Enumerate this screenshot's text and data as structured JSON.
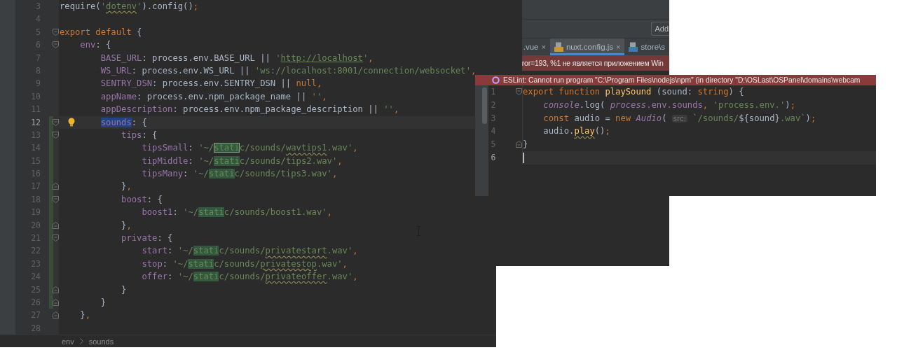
{
  "main_editor": {
    "lines": [
      {
        "number": "3",
        "tokens": [
          {
            "text": "require(",
            "kind": "plain"
          },
          {
            "text": "'",
            "kind": "string"
          },
          {
            "text": "dotenv",
            "kind": "string-typo"
          },
          {
            "text": "'",
            "kind": "string"
          },
          {
            "text": ").config()",
            "kind": "plain"
          },
          {
            "text": ";",
            "kind": "keyword"
          }
        ]
      },
      {
        "number": "4"
      },
      {
        "number": "5",
        "fold_open": true,
        "tokens": [
          {
            "text": "export default ",
            "kind": "keyword"
          },
          {
            "text": "{",
            "kind": "plain"
          }
        ]
      },
      {
        "number": "6",
        "fold_open": true,
        "tokens": [
          {
            "text": "    env",
            "kind": "key"
          },
          {
            "text": ": {",
            "kind": "plain"
          }
        ]
      },
      {
        "number": "7",
        "tokens": [
          {
            "text": "        BASE_URL",
            "kind": "key"
          },
          {
            "text": ": process.env.BASE_URL || ",
            "kind": "plain"
          },
          {
            "text": "'",
            "kind": "string"
          },
          {
            "text": "http://localhost",
            "kind": "string-link"
          },
          {
            "text": "'",
            "kind": "string"
          },
          {
            "text": ",",
            "kind": "keyword"
          }
        ]
      },
      {
        "number": "8",
        "tokens": [
          {
            "text": "        WS_URL",
            "kind": "key"
          },
          {
            "text": ": process.env.WS_URL || ",
            "kind": "plain"
          },
          {
            "text": "'ws://localhost:8001/connection/websocket'",
            "kind": "string"
          },
          {
            "text": ",",
            "kind": "keyword"
          }
        ]
      },
      {
        "number": "9",
        "tokens": [
          {
            "text": "        SENTRY_DSN",
            "kind": "key"
          },
          {
            "text": ": process.env.SENTRY_DSN || ",
            "kind": "plain"
          },
          {
            "text": "null,",
            "kind": "keyword"
          }
        ]
      },
      {
        "number": "10",
        "tokens": [
          {
            "text": "        appName",
            "kind": "key"
          },
          {
            "text": ": process.env.npm_package_name || ",
            "kind": "plain"
          },
          {
            "text": "''",
            "kind": "string"
          },
          {
            "text": ",",
            "kind": "keyword"
          }
        ]
      },
      {
        "number": "11",
        "tokens": [
          {
            "text": "        appDescription",
            "kind": "key"
          },
          {
            "text": ": process.env.npm_package_description || ",
            "kind": "plain"
          },
          {
            "text": "''",
            "kind": "string"
          },
          {
            "text": ",",
            "kind": "keyword"
          }
        ]
      },
      {
        "number": "12",
        "current": true,
        "changed": true,
        "fold_open": true,
        "bulb": true,
        "tokens": [
          {
            "text": "        sounds",
            "kind": "selected"
          },
          {
            "text": ": {",
            "kind": "plain"
          }
        ]
      },
      {
        "number": "13",
        "changed": true,
        "fold_open": true,
        "tokens": [
          {
            "text": "            tips",
            "kind": "key"
          },
          {
            "text": ": {",
            "kind": "plain"
          }
        ]
      },
      {
        "number": "14",
        "changed": true,
        "tokens": [
          {
            "text": "                tipsSmall",
            "kind": "key"
          },
          {
            "text": ": ",
            "kind": "plain"
          },
          {
            "text": "'~/",
            "kind": "string"
          },
          {
            "text": "stati",
            "kind": "match-current"
          },
          {
            "text": "c/sounds/",
            "kind": "string"
          },
          {
            "text": "wavtips1",
            "kind": "string-typo"
          },
          {
            "text": ".wav'",
            "kind": "string"
          },
          {
            "text": ",",
            "kind": "keyword"
          }
        ]
      },
      {
        "number": "15",
        "changed": true,
        "tokens": [
          {
            "text": "                tipMiddle",
            "kind": "key"
          },
          {
            "text": ": ",
            "kind": "plain"
          },
          {
            "text": "'~/",
            "kind": "string"
          },
          {
            "text": "stati",
            "kind": "match"
          },
          {
            "text": "c/sounds/tips2.wav'",
            "kind": "string"
          },
          {
            "text": ",",
            "kind": "keyword"
          }
        ]
      },
      {
        "number": "16",
        "changed": true,
        "tokens": [
          {
            "text": "                tipsMany",
            "kind": "key"
          },
          {
            "text": ": ",
            "kind": "plain"
          },
          {
            "text": "'~/",
            "kind": "string"
          },
          {
            "text": "stati",
            "kind": "match"
          },
          {
            "text": "c/sounds/tips3.wav'",
            "kind": "string"
          },
          {
            "text": ",",
            "kind": "keyword"
          }
        ]
      },
      {
        "number": "17",
        "changed": true,
        "fold_close": true,
        "tokens": [
          {
            "text": "            }",
            "kind": "plain"
          },
          {
            "text": ",",
            "kind": "keyword"
          }
        ]
      },
      {
        "number": "18",
        "changed": true,
        "fold_open": true,
        "tokens": [
          {
            "text": "            boost",
            "kind": "key"
          },
          {
            "text": ": {",
            "kind": "plain"
          }
        ]
      },
      {
        "number": "19",
        "changed": true,
        "tokens": [
          {
            "text": "                boost1",
            "kind": "key"
          },
          {
            "text": ": ",
            "kind": "plain"
          },
          {
            "text": "'~/",
            "kind": "string"
          },
          {
            "text": "stati",
            "kind": "match"
          },
          {
            "text": "c/sounds/boost1.wav'",
            "kind": "string"
          },
          {
            "text": ",",
            "kind": "keyword"
          }
        ]
      },
      {
        "number": "20",
        "changed": true,
        "fold_close": true,
        "tokens": [
          {
            "text": "            }",
            "kind": "plain"
          },
          {
            "text": ",",
            "kind": "keyword"
          }
        ]
      },
      {
        "number": "21",
        "changed": true,
        "fold_open": true,
        "tokens": [
          {
            "text": "            private",
            "kind": "key"
          },
          {
            "text": ": {",
            "kind": "plain"
          }
        ]
      },
      {
        "number": "22",
        "changed": true,
        "tokens": [
          {
            "text": "                start",
            "kind": "key"
          },
          {
            "text": ": ",
            "kind": "plain"
          },
          {
            "text": "'~/",
            "kind": "string"
          },
          {
            "text": "stati",
            "kind": "match"
          },
          {
            "text": "c/sounds/",
            "kind": "string"
          },
          {
            "text": "privatestart",
            "kind": "string-typo"
          },
          {
            "text": ".wav'",
            "kind": "string"
          },
          {
            "text": ",",
            "kind": "keyword"
          }
        ]
      },
      {
        "number": "23",
        "changed": true,
        "tokens": [
          {
            "text": "                stop",
            "kind": "key"
          },
          {
            "text": ": ",
            "kind": "plain"
          },
          {
            "text": "'~/",
            "kind": "string"
          },
          {
            "text": "stati",
            "kind": "match"
          },
          {
            "text": "c/sounds/",
            "kind": "string"
          },
          {
            "text": "privatestop",
            "kind": "string-typo"
          },
          {
            "text": ".wav'",
            "kind": "string"
          },
          {
            "text": ",",
            "kind": "keyword"
          }
        ]
      },
      {
        "number": "24",
        "changed": true,
        "tokens": [
          {
            "text": "                offer",
            "kind": "key"
          },
          {
            "text": ": ",
            "kind": "plain"
          },
          {
            "text": "'~/",
            "kind": "string"
          },
          {
            "text": "stati",
            "kind": "match"
          },
          {
            "text": "c/sounds/",
            "kind": "string"
          },
          {
            "text": "privateoffer",
            "kind": "string-typo"
          },
          {
            "text": ".wav'",
            "kind": "string"
          },
          {
            "text": ",",
            "kind": "keyword"
          }
        ]
      },
      {
        "number": "25",
        "changed": true,
        "fold_close": true,
        "tokens": [
          {
            "text": "            }",
            "kind": "plain"
          }
        ]
      },
      {
        "number": "26",
        "changed": true,
        "fold_close": true,
        "tokens": [
          {
            "text": "        }",
            "kind": "plain"
          }
        ]
      },
      {
        "number": "27",
        "fold_close": true,
        "tokens": [
          {
            "text": "    }",
            "kind": "plain"
          },
          {
            "text": ",",
            "kind": "keyword"
          }
        ]
      },
      {
        "number": "28"
      }
    ],
    "breadcrumbs": [
      {
        "label": "env"
      },
      {
        "label": "sounds"
      }
    ]
  },
  "second_window": {
    "button": "Add",
    "tabs": [
      {
        "label": ".vue",
        "close": "×",
        "selected": false,
        "kind": "vue"
      },
      {
        "label": "nuxt.config.js",
        "close": "×",
        "selected": true,
        "kind": "js"
      },
      {
        "label": "store\\s",
        "selected": false,
        "kind": "ts"
      }
    ],
    "error_banner": "ror=193, %1 не является приложением Win"
  },
  "third_window": {
    "banner": "ESLint: Cannot run program \"C:\\Program Files\\nodejs\\npm\" (in directory \"D:\\OSLast\\OSPanel\\domains\\webcam",
    "lines": [
      {
        "number": "1",
        "fold_open": true,
        "tokens": [
          {
            "text": "export function ",
            "kind": "keyword"
          },
          {
            "text": "playSound",
            "kind": "fn"
          },
          {
            "text": " (sound: ",
            "kind": "plain"
          },
          {
            "text": "string",
            "kind": "keyword"
          },
          {
            "text": ") {",
            "kind": "plain"
          }
        ]
      },
      {
        "number": "2",
        "tokens": [
          {
            "text": "    console",
            "kind": "italic-key"
          },
          {
            "text": ".log( ",
            "kind": "plain"
          },
          {
            "text": "process",
            "kind": "italic-key"
          },
          {
            "text": ".env.sounds",
            "kind": "key"
          },
          {
            "text": ", ",
            "kind": "keyword"
          },
          {
            "text": "'process.env.'",
            "kind": "string"
          },
          {
            "text": ")",
            "kind": "plain"
          },
          {
            "text": ";",
            "kind": "keyword"
          }
        ]
      },
      {
        "number": "3",
        "tokens": [
          {
            "text": "    const",
            "kind": "keyword"
          },
          {
            "text": " audio = ",
            "kind": "plain"
          },
          {
            "text": "new ",
            "kind": "keyword"
          },
          {
            "text": "Audio",
            "kind": "italic-key"
          },
          {
            "text": "( ",
            "kind": "plain"
          },
          {
            "text": "src:",
            "kind": "hint"
          },
          {
            "text": " `/sounds/",
            "kind": "string"
          },
          {
            "text": "${sound}",
            "kind": "plain"
          },
          {
            "text": ".wav`",
            "kind": "string"
          },
          {
            "text": ")",
            "kind": "plain"
          },
          {
            "text": ";",
            "kind": "keyword"
          }
        ]
      },
      {
        "number": "4",
        "tokens": [
          {
            "text": "    audio.",
            "kind": "plain"
          },
          {
            "text": "play",
            "kind": "fn-typo"
          },
          {
            "text": "()",
            "kind": "plain"
          },
          {
            "text": ";",
            "kind": "keyword"
          }
        ]
      },
      {
        "number": "5",
        "fold_close": true,
        "tokens": [
          {
            "text": "}",
            "kind": "plain"
          }
        ]
      },
      {
        "number": "6",
        "current": true,
        "caret": true
      }
    ]
  }
}
